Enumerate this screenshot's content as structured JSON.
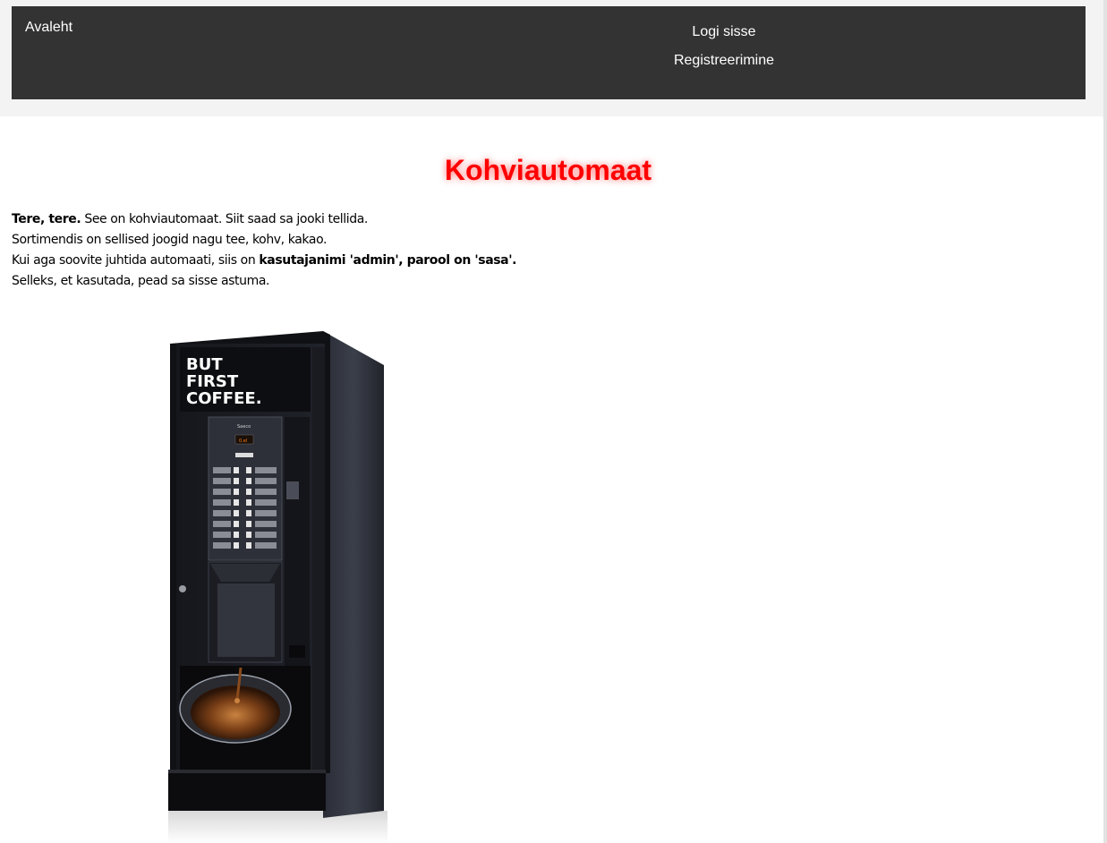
{
  "nav": {
    "home_label": "Avaleht",
    "login_label": "Logi sisse",
    "register_label": "Registreerimine"
  },
  "main": {
    "title": "Kohviautomaat",
    "greeting_bold": "Tere, tere.",
    "line1_rest": " See on kohviautomaat. Siit saad sa jooki tellida.",
    "line2": "Sortimendis on sellised joogid nagu tee, kohv, kakao.",
    "line3_start": "Kui aga soovite juhtida automaati, siis on ",
    "line3_bold": "kasutajanimi 'admin', parool on 'sasa'",
    "line3_end": ".",
    "line4": "Selleks, et kasutada, pead sa sisse astuma."
  },
  "machine": {
    "brand_text": "BUT FIRST COFFEE.",
    "maker_text": "Saeco",
    "display_text": "0.el"
  },
  "colors": {
    "navbar_bg": "#333333",
    "title_color": "#ff0000",
    "page_bg": "#f3f3f3"
  }
}
